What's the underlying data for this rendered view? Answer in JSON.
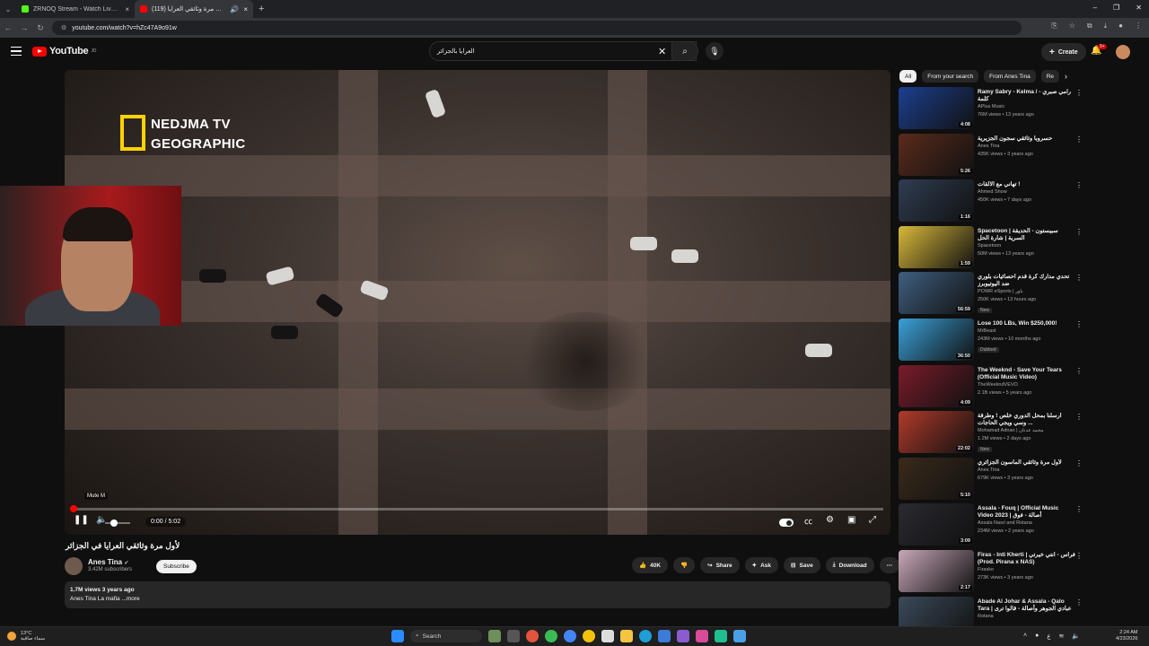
{
  "browser": {
    "tabs": [
      {
        "title": "ZRNOQ Stream - Watch Live on",
        "favicon_color": "#53fc18"
      },
      {
        "title": "(119) لأول مرة وثائقي العرايا",
        "favicon_color": "#ff0000",
        "close": "×"
      }
    ],
    "url": "youtube.com/watch?v=hZc47A9o91w"
  },
  "youtube": {
    "logo": "YouTube",
    "logo_country": "JO",
    "search_query": "العرايا بالجزائر",
    "create_label": "Create",
    "notif_count": "9+"
  },
  "player": {
    "watermark_line1": "NEDJMA TV",
    "watermark_line2": "GEOGRAPHIC",
    "mute_tooltip": "Mute  M",
    "time": "0:00 / 5:02",
    "progress": 0
  },
  "video": {
    "title": "لأول مرة وثائقي العرايا في الجزائر",
    "channel": "Anes Tina",
    "subscribers": "3.42M subscribers",
    "subscribe_label": "Subscribe",
    "likes": "40K",
    "share_label": "Share",
    "ask_label": "Ask",
    "save_label": "Save",
    "download_label": "Download",
    "views_age": "1.7M views  3 years ago",
    "description": "Anes Tina La mafia ...more"
  },
  "chips": [
    "All",
    "From your search",
    "From Anes Tina",
    "Re"
  ],
  "recommendations": [
    {
      "title": "Ramy Sabry - Kelma / رامي صبري - كلمة",
      "channel": "APlus Music",
      "views": "76M views • 13 years ago",
      "duration": "4:08",
      "color": "#1b3f8f"
    },
    {
      "title": "حسروبا وثائقي سجون الجزيرية",
      "channel": "Anes Tina",
      "views": "435K views • 3 years ago",
      "duration": "5:26",
      "color": "#5a2b1b"
    },
    {
      "title": "تهاني مع الالقات !",
      "channel": "Ahmed Show",
      "views": "450K views • 7 days ago",
      "duration": "1:16",
      "color": "#2f3d52"
    },
    {
      "title": "Spacetoon | سبيستون - الحديقة السرية | شارة الحل",
      "channel": "Spacetoon",
      "views": "50M views • 13 years ago",
      "duration": "1:59",
      "color": "#d8b83a"
    },
    {
      "title": "تحدي مدارك كرة قدم احصائيات بلوري ضد اليوتيوبرز",
      "channel": "POWR eSports | باور",
      "views": "250K views • 13 hours ago",
      "duration": "56:59",
      "tag": "New",
      "color": "#3f5f7f"
    },
    {
      "title": "Lose 100 LBs, Win $250,000!",
      "channel": "MrBeast",
      "views": "243M views • 10 months ago",
      "duration": "36:50",
      "tag": "Dubbed",
      "color": "#3aa0d8"
    },
    {
      "title": "The Weeknd - Save Your Tears (Official Music Video)",
      "channel": "TheWeekndVEVO",
      "views": "2.1B views • 5 years ago",
      "duration": "4:09",
      "color": "#7a1b2a"
    },
    {
      "title": "أرسلنا بمحل الدوري خلص ! وطرقة وسي ويجي الحاجات ...",
      "channel": "Mohamad Adnan | محمد عدنان",
      "views": "1.2M views • 2 days ago",
      "duration": "22:02",
      "tag": "New",
      "color": "#b03a2a"
    },
    {
      "title": "لأول مرة وثائقي الماسون الجزائري",
      "channel": "Anes Tina",
      "views": "679K views • 3 years ago",
      "duration": "5:10",
      "color": "#3a2a1a"
    },
    {
      "title": "Assala - Fouq | Official Music Video 2023 | أصالة - فوق",
      "channel": "Assala Nasri and Rotana",
      "views": "234M views • 2 years ago",
      "duration": "3:09",
      "color": "#2a2a30"
    },
    {
      "title": "Firas - Inti Kherti | فراس - انتي خيرتي (Prod. Pirana x NAS)",
      "channel": "Firasko",
      "views": "273K views • 3 years ago",
      "duration": "2:17",
      "color": "#c8a8b8"
    },
    {
      "title": "Abade Al Johar & Assala - Qalo Tara | عبادي الجوهر وأصالة - قالوا ترى",
      "channel": "Rotana",
      "views": "",
      "duration": "",
      "color": "#3a4a5a"
    }
  ],
  "taskbar": {
    "weather_temp": "13°C",
    "weather_desc": "سماء صافية",
    "search_label": "Search",
    "time": "2:24 AM",
    "date": "4/23/2026"
  }
}
